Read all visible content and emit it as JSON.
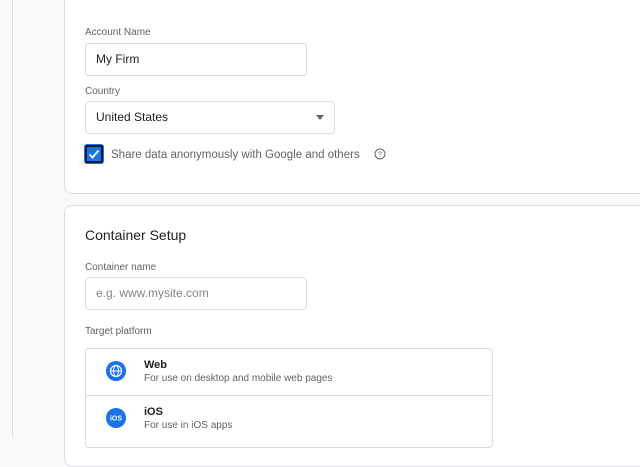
{
  "account": {
    "name_label": "Account Name",
    "name_value": "My Firm",
    "country_label": "Country",
    "country_value": "United States",
    "share_checkbox_label": "Share data anonymously with Google and others",
    "share_checked": true
  },
  "container": {
    "title": "Container Setup",
    "name_label": "Container name",
    "name_placeholder": "e.g. www.mysite.com",
    "target_label": "Target platform",
    "platforms": [
      {
        "title": "Web",
        "desc": "For use on desktop and mobile web pages",
        "icon": "globe-icon"
      },
      {
        "title": "iOS",
        "desc": "For use in iOS apps",
        "icon": "ios-icon",
        "icon_text": "iOS"
      }
    ]
  },
  "colors": {
    "accent": "#1a73e8",
    "border": "#dadce0",
    "muted": "#5f6368"
  }
}
